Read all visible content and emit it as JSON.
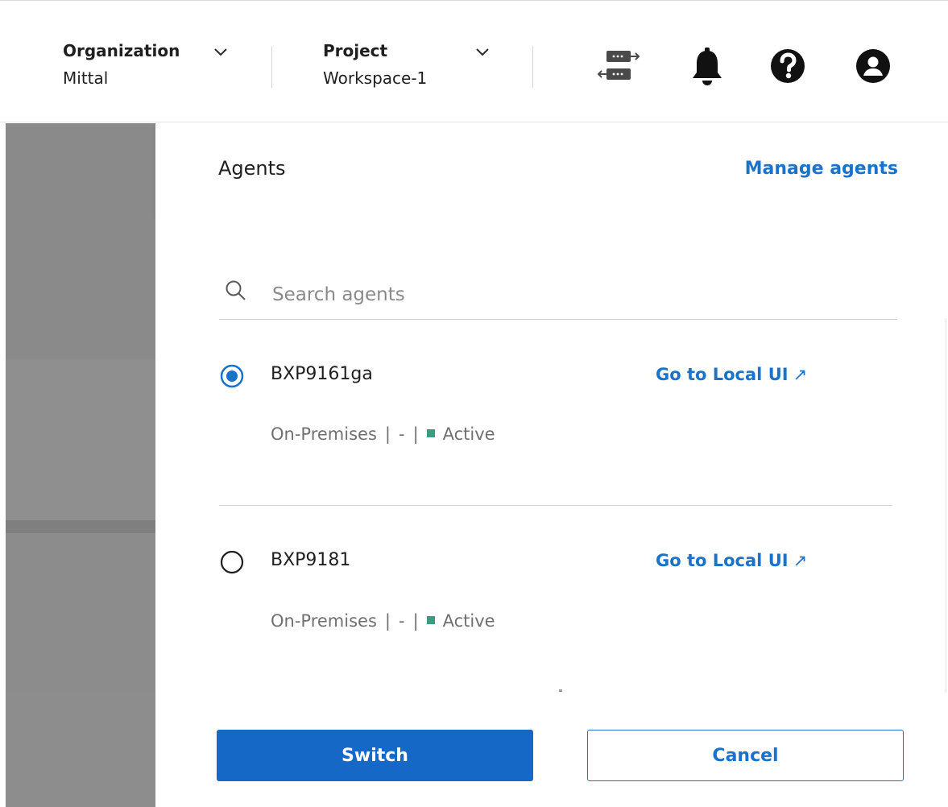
{
  "header": {
    "organization": {
      "label": "Organization",
      "value": "Mittal"
    },
    "project": {
      "label": "Project",
      "value": "Workspace-1"
    },
    "icons": [
      "agent-switch-icon",
      "bell-icon",
      "help-icon",
      "user-icon"
    ]
  },
  "panel": {
    "title": "Agents",
    "manage_link": "Manage agents",
    "search": {
      "placeholder": "Search agents",
      "value": ""
    },
    "agents": [
      {
        "name": "BXP9161ga",
        "selected": true,
        "link": "Go to Local UI",
        "link_icon": "↗",
        "type": "On-Premises",
        "separator": "|",
        "detail": "-",
        "status": "Active"
      },
      {
        "name": "BXP9181",
        "selected": false,
        "link": "Go to Local UI",
        "link_icon": "↗",
        "type": "On-Premises",
        "separator": "|",
        "detail": "-",
        "status": "Active"
      }
    ]
  },
  "footer": {
    "switch_label": "Switch",
    "cancel_label": "Cancel"
  },
  "colors": {
    "accent": "#1a73c9",
    "primary_button": "#1668c7",
    "status_active": "#3c9b80",
    "backdrop": "#8c8c8c"
  }
}
